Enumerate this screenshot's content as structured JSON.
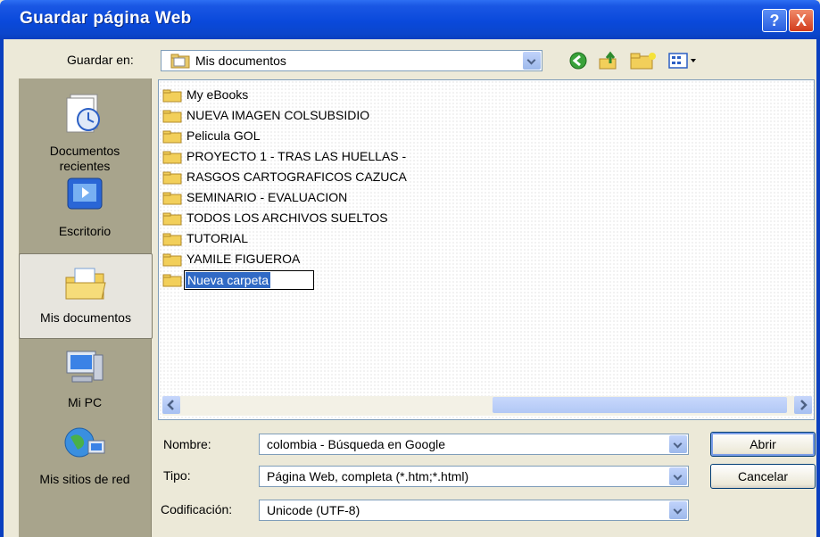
{
  "dialog": {
    "title": "Guardar página Web",
    "help_label": "?",
    "close_label": "X"
  },
  "save_in": {
    "label": "Guardar en:",
    "value": "Mis documentos"
  },
  "toolbar": {
    "icons": [
      "back-icon",
      "up-folder-icon",
      "new-folder-icon",
      "view-menu-icon"
    ]
  },
  "places": [
    {
      "label": "Documentos recientes",
      "icon": "recent-documents-icon"
    },
    {
      "label": "Escritorio",
      "icon": "desktop-icon"
    },
    {
      "label": "Mis documentos",
      "icon": "my-documents-icon",
      "selected": true
    },
    {
      "label": "Mi PC",
      "icon": "my-computer-icon"
    },
    {
      "label": "Mis sitios de red",
      "icon": "network-places-icon"
    }
  ],
  "files": [
    "My eBooks",
    "NUEVA IMAGEN COLSUBSIDIO",
    "Pelicula GOL",
    "PROYECTO 1 - TRAS LAS HUELLAS -",
    "RASGOS CARTOGRAFICOS CAZUCA",
    "SEMINARIO - EVALUACION",
    "TODOS LOS ARCHIVOS SUELTOS",
    "TUTORIAL",
    "YAMILE FIGUEROA"
  ],
  "renaming_folder": "Nueva carpeta",
  "form": {
    "name_label": "Nombre:",
    "name_value": "colombia - Búsqueda en Google",
    "type_label": "Tipo:",
    "type_value": "Página Web, completa (*.htm;*.html)",
    "encoding_label": "Codificación:",
    "encoding_value": "Unicode (UTF-8)"
  },
  "buttons": {
    "open": "Abrir",
    "cancel": "Cancelar"
  },
  "colors": {
    "titlebar": "#0a49db",
    "dialog_bg": "#ece9d8",
    "places_bar": "#a8a48c",
    "selection": "#316ac5"
  }
}
